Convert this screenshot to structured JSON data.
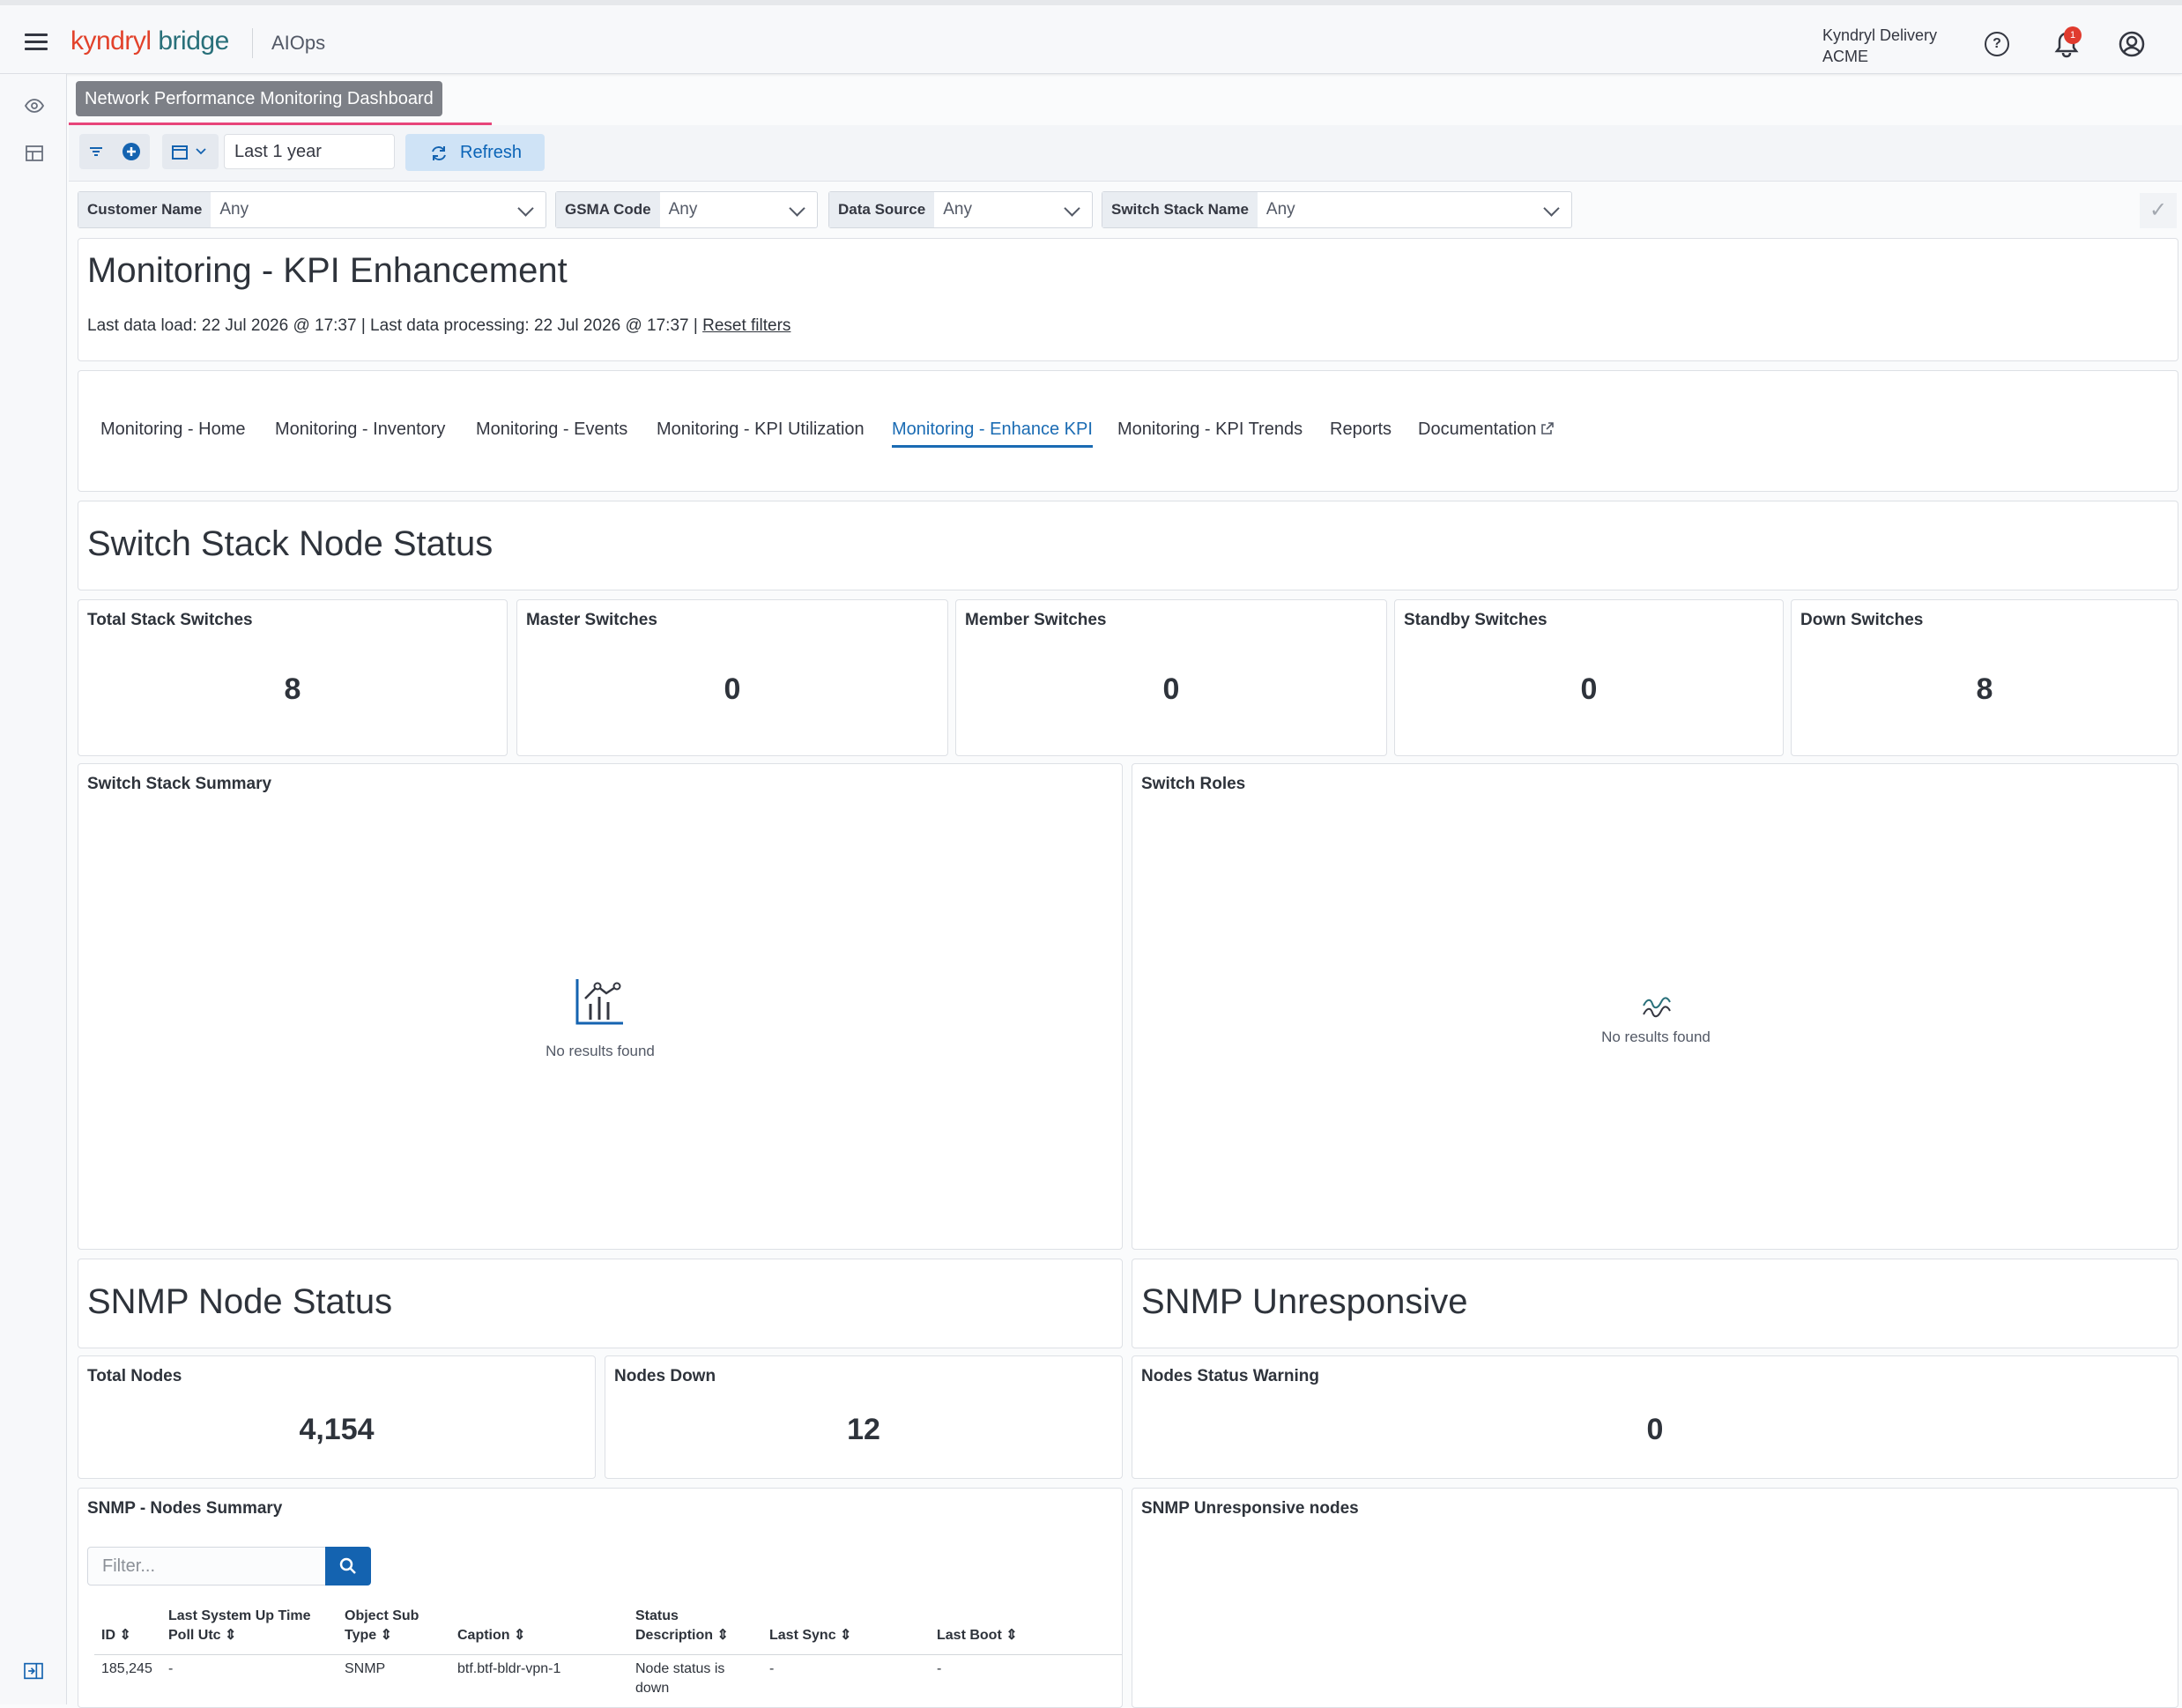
{
  "header": {
    "logo_kyndryl": "kyndryl",
    "logo_bridge": "bridge",
    "app_name": "AIOps",
    "org_line1": "Kyndryl Delivery",
    "org_line2": "ACME",
    "notification_count": "1",
    "help_icon": "question-circle-icon",
    "bell_icon": "bell-icon",
    "user_icon": "user-circle-icon"
  },
  "dashboard_title": "Network Performance Monitoring Dashboard",
  "toolbar": {
    "time_range": "Last 1 year",
    "refresh_label": "Refresh"
  },
  "filters": [
    {
      "label": "Customer Name",
      "value": "Any"
    },
    {
      "label": "GSMA Code",
      "value": "Any"
    },
    {
      "label": "Data Source",
      "value": "Any"
    },
    {
      "label": "Switch Stack Name",
      "value": "Any"
    }
  ],
  "page": {
    "title": "Monitoring - KPI Enhancement",
    "load_info": "Last data load: 22 Jul 2026 @ 17:37 | Last data processing: 22 Jul 2026 @ 17:37 |",
    "reset_filters": "Reset filters"
  },
  "tabs": [
    {
      "label": "Monitoring - Home"
    },
    {
      "label": "Monitoring - Inventory"
    },
    {
      "label": "Monitoring - Events"
    },
    {
      "label": "Monitoring - KPI Utilization"
    },
    {
      "label": "Monitoring - Enhance KPI"
    },
    {
      "label": "Monitoring - KPI Trends"
    },
    {
      "label": "Reports"
    },
    {
      "label": "Documentation"
    }
  ],
  "switch_section": {
    "title": "Switch Stack Node Status",
    "metrics": [
      {
        "label": "Total Stack Switches",
        "value": "8"
      },
      {
        "label": "Master Switches",
        "value": "0"
      },
      {
        "label": "Member Switches",
        "value": "0"
      },
      {
        "label": "Standby Switches",
        "value": "0"
      },
      {
        "label": "Down Switches",
        "value": "8"
      }
    ],
    "summary_title": "Switch Stack Summary",
    "roles_title": "Switch Roles",
    "no_results": "No results found"
  },
  "snmp_section": {
    "title": "SNMP Node Status",
    "unresponsive_title": "SNMP Unresponsive",
    "metrics": [
      {
        "label": "Total Nodes",
        "value": "4,154"
      },
      {
        "label": "Nodes Down",
        "value": "12"
      },
      {
        "label": "Nodes Status Warning",
        "value": "0"
      }
    ],
    "summary_title": "SNMP - Nodes Summary",
    "unresponsive_nodes_title": "SNMP Unresponsive nodes",
    "filter_placeholder": "Filter...",
    "columns": [
      {
        "line1": "ID",
        "line2": ""
      },
      {
        "line1": "Last System Up Time",
        "line2": "Poll Utc"
      },
      {
        "line1": "Object Sub",
        "line2": "Type"
      },
      {
        "line1": "Caption",
        "line2": ""
      },
      {
        "line1": "Status",
        "line2": "Description"
      },
      {
        "line1": "Last Sync",
        "line2": ""
      },
      {
        "line1": "Last Boot",
        "line2": ""
      }
    ],
    "rows": [
      {
        "id": "185,245",
        "uptime": "-",
        "subtype": "SNMP",
        "caption": "btf.btf-bldr-vpn-1",
        "status1": "Node status is",
        "status2": "down",
        "sync": "-",
        "boot": "-"
      }
    ]
  }
}
